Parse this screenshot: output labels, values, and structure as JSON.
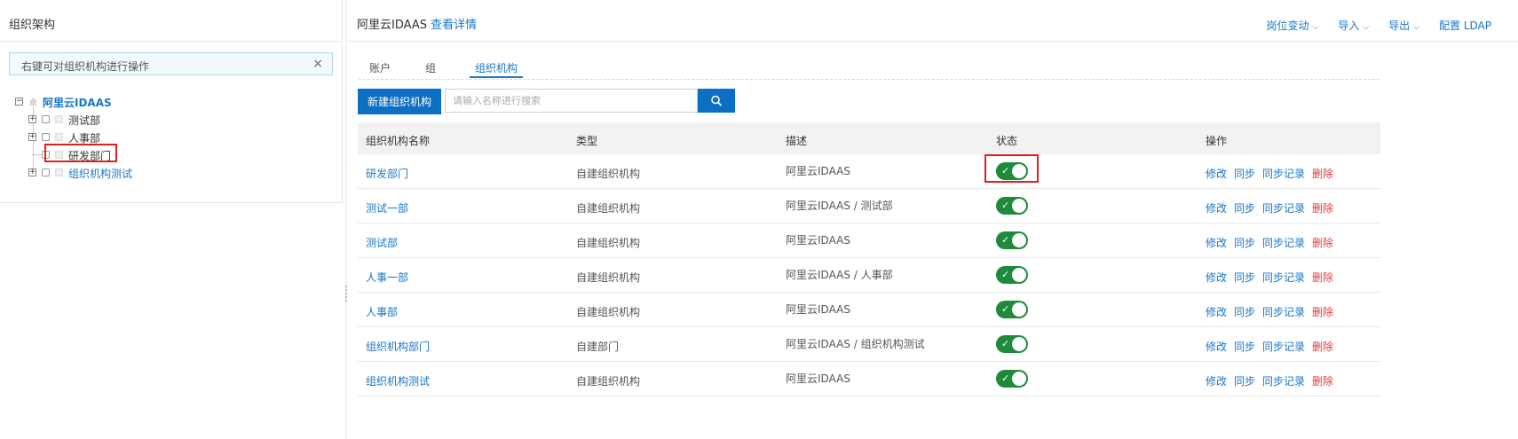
{
  "left_panel": {
    "title": "组织架构",
    "hint": "右键可对组织机构进行操作",
    "close_glyph": "×",
    "tree": {
      "root": {
        "label": "阿里云IDAAS",
        "expander": "−"
      },
      "children": [
        {
          "label": "测试部",
          "expander": "+"
        },
        {
          "label": "人事部",
          "expander": "+"
        },
        {
          "label": "研发部门",
          "expander": ""
        },
        {
          "label": "组织机构测试",
          "expander": "+"
        }
      ]
    }
  },
  "header": {
    "title": "阿里云IDAAS",
    "detail_link": "查看详情",
    "actions": [
      "岗位变动",
      "导入",
      "导出",
      "配置 LDAP"
    ]
  },
  "tabs": [
    {
      "label": "账户"
    },
    {
      "label": "组"
    },
    {
      "label": "组织机构",
      "active": true
    }
  ],
  "toolbar": {
    "new_button": "新建组织机构",
    "search_placeholder": "请输入名称进行搜索"
  },
  "table": {
    "columns": [
      "组织机构名称",
      "类型",
      "描述",
      "状态",
      "操作"
    ],
    "rows": [
      {
        "name": "研发部门",
        "type": "自建组织机构",
        "desc": "阿里云IDAAS",
        "enabled": true
      },
      {
        "name": "测试一部",
        "type": "自建组织机构",
        "desc": "阿里云IDAAS / 测试部",
        "enabled": true
      },
      {
        "name": "测试部",
        "type": "自建组织机构",
        "desc": "阿里云IDAAS",
        "enabled": true
      },
      {
        "name": "人事一部",
        "type": "自建组织机构",
        "desc": "阿里云IDAAS / 人事部",
        "enabled": true
      },
      {
        "name": "人事部",
        "type": "自建组织机构",
        "desc": "阿里云IDAAS",
        "enabled": true
      },
      {
        "name": "组织机构部门",
        "type": "自建部门",
        "desc": "阿里云IDAAS / 组织机构测试",
        "enabled": true
      },
      {
        "name": "组织机构测试",
        "type": "自建组织机构",
        "desc": "阿里云IDAAS",
        "enabled": true
      }
    ],
    "row_actions": [
      "修改",
      "同步",
      "同步记录",
      "删除"
    ]
  },
  "colors": {
    "accent": "#1877c9",
    "primary_button": "#0b6fc4",
    "toggle_on": "#1f8a3b",
    "danger": "#e23c3c",
    "highlight_box": "#e02020"
  }
}
